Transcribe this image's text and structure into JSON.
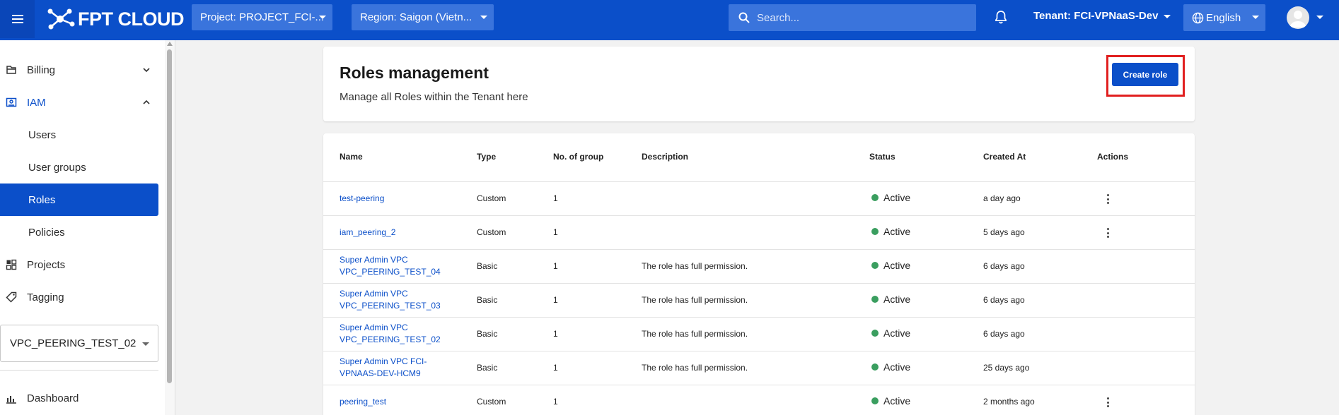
{
  "brand": {
    "name": "FPT CLOUD"
  },
  "topbar": {
    "project_label": "Project: PROJECT_FCI-...",
    "region_label": "Region: Saigon (Vietn...",
    "search_placeholder": "Search...",
    "tenant_label": "Tenant: FCI-VPNaaS-Dev",
    "language_label": "English"
  },
  "sidebar": {
    "items": [
      {
        "label": "Billing",
        "icon": "billing-icon"
      },
      {
        "label": "IAM",
        "icon": "iam-icon"
      },
      {
        "label": "Users"
      },
      {
        "label": "User groups"
      },
      {
        "label": "Roles",
        "active": true
      },
      {
        "label": "Policies"
      },
      {
        "label": "Projects",
        "icon": "projects-icon"
      },
      {
        "label": "Tagging",
        "icon": "tag-icon"
      },
      {
        "label": "Dashboard",
        "icon": "dashboard-icon"
      }
    ],
    "project_select": "VPC_PEERING_TEST_02"
  },
  "page": {
    "title": "Roles management",
    "subtitle": "Manage all Roles within the Tenant here",
    "create_button": "Create role"
  },
  "table": {
    "columns": [
      "Name",
      "Type",
      "No. of group",
      "Description",
      "Status",
      "Created At",
      "Actions"
    ],
    "rows": [
      {
        "name": "test-peering",
        "name2": "",
        "type": "Custom",
        "groups": "1",
        "description": "",
        "status": "Active",
        "created": "a day ago",
        "actions": true
      },
      {
        "name": "iam_peering_2",
        "name2": "",
        "type": "Custom",
        "groups": "1",
        "description": "",
        "status": "Active",
        "created": "5 days ago",
        "actions": true
      },
      {
        "name": "Super Admin VPC",
        "name2": "VPC_PEERING_TEST_04",
        "type": "Basic",
        "groups": "1",
        "description": "The role has full permission.",
        "status": "Active",
        "created": "6 days ago",
        "actions": false
      },
      {
        "name": "Super Admin VPC",
        "name2": "VPC_PEERING_TEST_03",
        "type": "Basic",
        "groups": "1",
        "description": "The role has full permission.",
        "status": "Active",
        "created": "6 days ago",
        "actions": false
      },
      {
        "name": "Super Admin VPC",
        "name2": "VPC_PEERING_TEST_02",
        "type": "Basic",
        "groups": "1",
        "description": "The role has full permission.",
        "status": "Active",
        "created": "6 days ago",
        "actions": false
      },
      {
        "name": "Super Admin VPC FCI-",
        "name2": "VPNAAS-DEV-HCM9",
        "type": "Basic",
        "groups": "1",
        "description": "The role has full permission.",
        "status": "Active",
        "created": "25 days ago",
        "actions": false
      },
      {
        "name": "peering_test",
        "name2": "",
        "type": "Custom",
        "groups": "1",
        "description": "",
        "status": "Active",
        "created": "2 months ago",
        "actions": true
      }
    ]
  },
  "colors": {
    "primary": "#0b4fc9",
    "active_status": "#3a9e5f",
    "highlight": "#e11f1f"
  }
}
